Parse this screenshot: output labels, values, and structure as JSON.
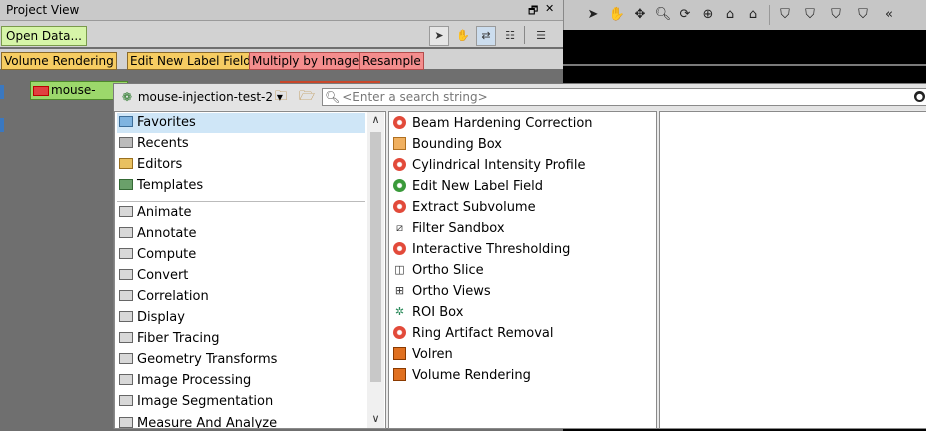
{
  "project_view": {
    "title": "Project View",
    "controls": {
      "float": "🗗",
      "close": "✕"
    },
    "open_data_label": "Open Data...",
    "toolbar_icons": [
      "pointer-icon",
      "hand-icon",
      "connect-icon",
      "tree-icon",
      "layout-icon"
    ],
    "module_buttons": [
      {
        "label": "Volume Rendering",
        "color": "#f6cc62"
      },
      {
        "label": "Edit New Label Field",
        "color": "#f6cc62"
      },
      {
        "label": "Multiply by Image",
        "color": "#f48d8d"
      },
      {
        "label": "Resample",
        "color": "#f48d8d"
      }
    ],
    "data_node_label": "mouse-injection-test-2"
  },
  "viewer_toolbar": {
    "icons": [
      "pointer-icon",
      "hand-icon",
      "translate-icon",
      "zoom-icon",
      "rotate-icon",
      "seek-icon",
      "home-icon",
      "set-home-icon",
      "view-shield-icon",
      "view-a-icon",
      "view-b-icon",
      "view-c-icon",
      "view-d-icon"
    ]
  },
  "popup": {
    "data_select": "mouse-injection-test-2",
    "search_placeholder": "<Enter a search string>",
    "categories": [
      {
        "label": "Favorites",
        "icon": "favorites-folder-icon",
        "selected": true
      },
      {
        "label": "Recents",
        "icon": "recents-folder-icon"
      },
      {
        "label": "Editors",
        "icon": "editors-folder-icon"
      },
      {
        "label": "Templates",
        "icon": "templates-folder-icon"
      },
      {
        "label": "Animate",
        "icon": "folder-icon"
      },
      {
        "label": "Annotate",
        "icon": "folder-icon"
      },
      {
        "label": "Compute",
        "icon": "folder-icon"
      },
      {
        "label": "Convert",
        "icon": "folder-icon"
      },
      {
        "label": "Correlation",
        "icon": "folder-icon"
      },
      {
        "label": "Display",
        "icon": "folder-icon"
      },
      {
        "label": "Fiber Tracing",
        "icon": "folder-icon"
      },
      {
        "label": "Geometry Transforms",
        "icon": "folder-icon"
      },
      {
        "label": "Image Processing",
        "icon": "folder-icon"
      },
      {
        "label": "Image Segmentation",
        "icon": "folder-icon"
      },
      {
        "label": "Measure And Analyze",
        "icon": "folder-icon"
      }
    ],
    "modules": [
      {
        "label": "Beam Hardening Correction",
        "icon": "red-gear-icon"
      },
      {
        "label": "Bounding Box",
        "icon": "box-icon"
      },
      {
        "label": "Cylindrical Intensity Profile",
        "icon": "red-gear-icon"
      },
      {
        "label": "Edit New Label Field",
        "icon": "green-gear-icon"
      },
      {
        "label": "Extract Subvolume",
        "icon": "red-gear-icon"
      },
      {
        "label": "Filter Sandbox",
        "icon": "sandbox-icon"
      },
      {
        "label": "Interactive Thresholding",
        "icon": "red-gear-icon"
      },
      {
        "label": "Ortho Slice",
        "icon": "ortho-slice-icon"
      },
      {
        "label": "Ortho Views",
        "icon": "ortho-views-icon"
      },
      {
        "label": "ROI Box",
        "icon": "roi-box-icon"
      },
      {
        "label": "Ring Artifact Removal",
        "icon": "red-gear-icon"
      },
      {
        "label": "Volren",
        "icon": "orange-cube-icon"
      },
      {
        "label": "Volume Rendering",
        "icon": "orange-cube-icon"
      }
    ]
  }
}
